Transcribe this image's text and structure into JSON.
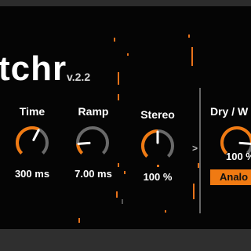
{
  "plugin": {
    "title": "tchr",
    "version": "v.2.2"
  },
  "controls": {
    "time": {
      "label": "Time",
      "value": "300 ms",
      "level": 0.6
    },
    "ramp": {
      "label": "Ramp",
      "value": "7.00 ms",
      "level": 0.15
    },
    "stereo": {
      "label": "Stereo",
      "value": "100 %",
      "level": 0.5
    },
    "drywet": {
      "label": "Dry / W",
      "value": "100 %",
      "level": 0.85
    }
  },
  "signal_arrow": ">",
  "mode_button": {
    "label": "Analo"
  },
  "colors": {
    "accent": "#f07a12",
    "knob_track": "#6a6a6a",
    "background": "#050505"
  }
}
